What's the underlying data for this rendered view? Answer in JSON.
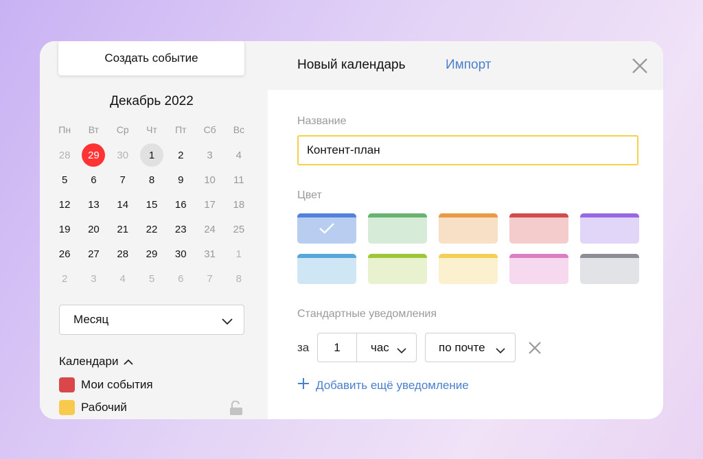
{
  "left_panel": {
    "create_button": "Создать событие",
    "month_title": "Декабрь 2022",
    "weekdays": [
      "Пн",
      "Вт",
      "Ср",
      "Чт",
      "Пт",
      "Сб",
      "Вс"
    ],
    "weeks": [
      [
        "28",
        "29",
        "30",
        "1",
        "2",
        "3",
        "4"
      ],
      [
        "5",
        "6",
        "7",
        "8",
        "9",
        "10",
        "11"
      ],
      [
        "12",
        "13",
        "14",
        "15",
        "16",
        "17",
        "18"
      ],
      [
        "19",
        "20",
        "21",
        "22",
        "23",
        "24",
        "25"
      ],
      [
        "26",
        "27",
        "28",
        "29",
        "30",
        "31",
        "1"
      ],
      [
        "2",
        "3",
        "4",
        "5",
        "6",
        "7",
        "8"
      ]
    ],
    "view_select": "Месяц",
    "calendars_header": "Календари",
    "calendars": [
      {
        "label": "Мои события",
        "color": "#d9474b"
      },
      {
        "label": "Рабочий",
        "color": "#f7c94d"
      }
    ]
  },
  "dialog": {
    "tab_new": "Новый календарь",
    "tab_import": "Импорт",
    "name_label": "Название",
    "name_value": "Контент-план",
    "color_label": "Цвет",
    "colors": [
      [
        {
          "bar": "#5282dc",
          "fill": "#b9cdf1",
          "selected": true
        },
        {
          "bar": "#67b36f",
          "fill": "#d6ecd9"
        },
        {
          "bar": "#e99a45",
          "fill": "#f8e0c6"
        },
        {
          "bar": "#d04d4b",
          "fill": "#f3cccb"
        },
        {
          "bar": "#9568e4",
          "fill": "#e2d6f8"
        }
      ],
      [
        {
          "bar": "#56a7dc",
          "fill": "#cfe6f5"
        },
        {
          "bar": "#9fc639",
          "fill": "#e8f2cf"
        },
        {
          "bar": "#f5cf53",
          "fill": "#fcf1cf"
        },
        {
          "bar": "#dc7ec4",
          "fill": "#f6d9ee"
        },
        {
          "bar": "#8c8d96",
          "fill": "#e2e3e6"
        }
      ]
    ],
    "notifications_label": "Стандартные уведомления",
    "notify_prefix": "за",
    "notify_amount": "1",
    "notify_unit": "час",
    "notify_method": "по почте",
    "add_notification": "Добавить ещё уведомление"
  },
  "accent_colors": {
    "link": "#4a7fcd",
    "today": "#ff3333",
    "focus": "#f5d149"
  }
}
